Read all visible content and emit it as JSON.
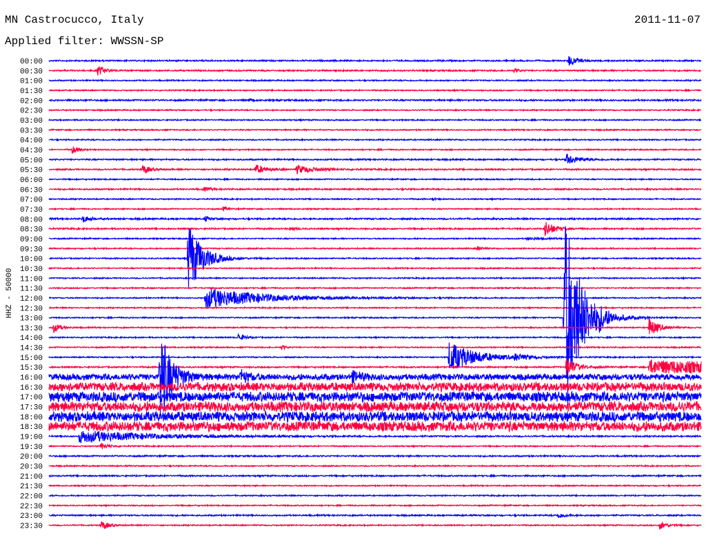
{
  "header": {
    "station": "MN Castrocucco, Italy",
    "filter": "Applied filter: WWSSN-SP",
    "date": "2011-11-07"
  },
  "chart_data": {
    "type": "line",
    "title": "MN Castrocucco, Italy",
    "ylabel": "HHZ - 50000",
    "x_minutes_per_line": 30,
    "colors": [
      "#0000ff",
      "#ff0040"
    ],
    "traces": [
      {
        "label": "00:00",
        "noise": 1.2,
        "events": [
          [
            23.9,
            8,
            0.3
          ]
        ]
      },
      {
        "label": "00:30",
        "noise": 1.2,
        "events": [
          [
            2.25,
            7,
            0.3
          ],
          [
            21.4,
            3,
            0.2
          ]
        ]
      },
      {
        "label": "01:00",
        "noise": 1.0,
        "events": []
      },
      {
        "label": "01:30",
        "noise": 1.0,
        "events": []
      },
      {
        "label": "02:00",
        "noise": 1.3,
        "events": [
          [
            9.2,
            2,
            0.2
          ]
        ]
      },
      {
        "label": "02:30",
        "noise": 1.0,
        "events": []
      },
      {
        "label": "03:00",
        "noise": 1.0,
        "events": []
      },
      {
        "label": "03:30",
        "noise": 1.0,
        "events": []
      },
      {
        "label": "04:00",
        "noise": 1.0,
        "events": []
      },
      {
        "label": "04:30",
        "noise": 1.0,
        "events": [
          [
            1.08,
            6,
            0.25
          ]
        ]
      },
      {
        "label": "05:00",
        "noise": 1.2,
        "events": [
          [
            23.8,
            8,
            0.5
          ]
        ]
      },
      {
        "label": "05:30",
        "noise": 1.2,
        "events": [
          [
            4.3,
            7,
            0.3
          ],
          [
            9.5,
            7,
            0.4
          ],
          [
            11.4,
            6,
            0.8
          ]
        ]
      },
      {
        "label": "06:00",
        "noise": 1.0,
        "events": []
      },
      {
        "label": "06:30",
        "noise": 1.2,
        "events": [
          [
            7.1,
            3,
            0.3
          ]
        ]
      },
      {
        "label": "07:00",
        "noise": 1.0,
        "events": [
          [
            17.6,
            2,
            0.2
          ]
        ]
      },
      {
        "label": "07:30",
        "noise": 1.0,
        "events": [
          [
            8.0,
            3,
            0.2
          ]
        ]
      },
      {
        "label": "08:00",
        "noise": 1.3,
        "events": [
          [
            1.55,
            5,
            0.3
          ],
          [
            7.2,
            4,
            0.2
          ]
        ]
      },
      {
        "label": "08:30",
        "noise": 1.2,
        "events": [
          [
            11.1,
            3,
            0.2
          ],
          [
            22.8,
            12,
            0.4
          ]
        ]
      },
      {
        "label": "09:00",
        "noise": 1.0,
        "events": [
          [
            22.0,
            2,
            0.5
          ]
        ]
      },
      {
        "label": "09:30",
        "noise": 1.0,
        "events": [
          [
            19.7,
            3,
            0.2
          ]
        ]
      },
      {
        "label": "10:00",
        "noise": 1.0,
        "events": [
          [
            6.4,
            55,
            0.6
          ]
        ]
      },
      {
        "label": "10:30",
        "noise": 1.0,
        "events": []
      },
      {
        "label": "11:00",
        "noise": 1.0,
        "events": []
      },
      {
        "label": "11:30",
        "noise": 1.0,
        "events": []
      },
      {
        "label": "12:00",
        "noise": 1.0,
        "events": [
          [
            7.2,
            15,
            2.5
          ]
        ]
      },
      {
        "label": "12:30",
        "noise": 1.0,
        "events": []
      },
      {
        "label": "13:00",
        "noise": 1.0,
        "events": [
          [
            23.7,
            160,
            0.7
          ],
          [
            25.3,
            6,
            0.3
          ]
        ]
      },
      {
        "label": "13:30",
        "noise": 1.0,
        "events": [
          [
            0.2,
            7,
            0.3
          ],
          [
            27.6,
            14,
            0.4
          ]
        ]
      },
      {
        "label": "14:00",
        "noise": 1.0,
        "events": [
          [
            8.7,
            5,
            0.3
          ]
        ]
      },
      {
        "label": "14:30",
        "noise": 1.0,
        "events": [
          [
            10.7,
            3,
            0.2
          ]
        ]
      },
      {
        "label": "15:00",
        "noise": 1.0,
        "events": [
          [
            18.4,
            22,
            1.2
          ],
          [
            21.4,
            4,
            0.5
          ]
        ]
      },
      {
        "label": "15:30",
        "noise": 1.2,
        "events": [
          [
            23.8,
            15,
            0.4
          ],
          [
            27.6,
            10,
            8
          ]
        ]
      },
      {
        "label": "16:00",
        "noise": 5,
        "events": [
          [
            5.1,
            70,
            0.5
          ],
          [
            8.8,
            8,
            0.4
          ],
          [
            13.9,
            8,
            0.4
          ]
        ]
      },
      {
        "label": "16:30",
        "noise": 7,
        "events": []
      },
      {
        "label": "17:00",
        "noise": 8,
        "events": []
      },
      {
        "label": "17:30",
        "noise": 8,
        "events": []
      },
      {
        "label": "18:00",
        "noise": 8,
        "events": []
      },
      {
        "label": "18:30",
        "noise": 8,
        "events": []
      },
      {
        "label": "19:00",
        "noise": 1.2,
        "events": [
          [
            1.4,
            9,
            3
          ]
        ]
      },
      {
        "label": "19:30",
        "noise": 1.0,
        "events": [
          [
            2.4,
            5,
            0.3
          ]
        ]
      },
      {
        "label": "20:00",
        "noise": 1.2,
        "events": []
      },
      {
        "label": "20:30",
        "noise": 1.0,
        "events": []
      },
      {
        "label": "21:00",
        "noise": 1.2,
        "events": []
      },
      {
        "label": "21:30",
        "noise": 1.0,
        "events": []
      },
      {
        "label": "22:00",
        "noise": 1.0,
        "events": []
      },
      {
        "label": "22:30",
        "noise": 1.0,
        "events": []
      },
      {
        "label": "23:00",
        "noise": 1.2,
        "events": [
          [
            23.4,
            4,
            0.3
          ]
        ]
      },
      {
        "label": "23:30",
        "noise": 1.0,
        "events": [
          [
            2.4,
            7,
            0.3
          ],
          [
            28.1,
            6,
            0.3
          ]
        ]
      }
    ]
  }
}
